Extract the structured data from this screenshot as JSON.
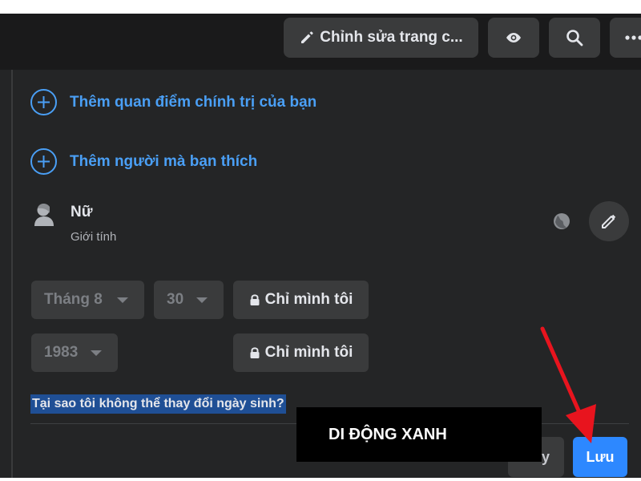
{
  "topbar": {
    "edit_page_label": "Chỉnh sửa trang c...",
    "icons": [
      "pencil-icon",
      "eye-icon",
      "search-icon",
      "more-icon"
    ]
  },
  "about": {
    "add_political_views": "Thêm quan điểm chính trị của bạn",
    "add_interested_in": "Thêm người mà bạn thích",
    "gender_value": "Nữ",
    "gender_caption": "Giới tính"
  },
  "birthday": {
    "month": "Tháng 8",
    "day": "30",
    "year": "1983",
    "privacy_day_label": "Chỉ mình tôi",
    "privacy_year_label": "Chỉ mình tôi",
    "why_link": "Tại sao tôi không thể thay đổi ngày sinh?"
  },
  "actions": {
    "cancel_label": "Hủy",
    "save_label": "Lưu"
  },
  "watermark": "DI ĐỘNG XANH",
  "colors": {
    "panel_bg": "#242526",
    "button_bg": "#3a3b3c",
    "link_blue": "#4a9ff5",
    "primary_blue": "#2d88ff",
    "annotation_red": "#e8141e"
  }
}
